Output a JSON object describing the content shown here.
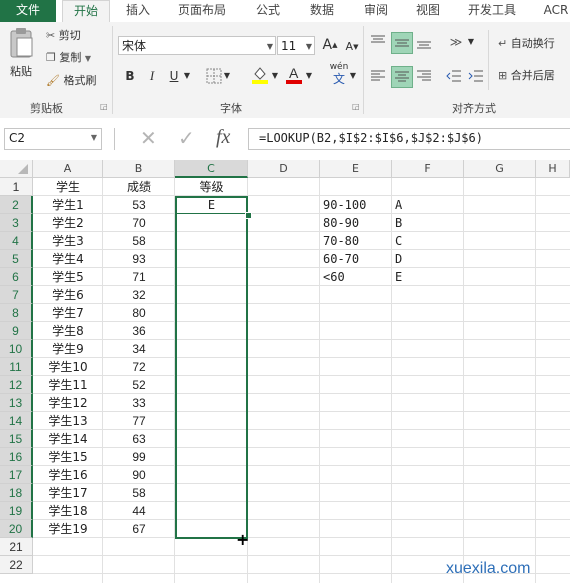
{
  "tabs": [
    "文件",
    "开始",
    "插入",
    "页面布局",
    "公式",
    "数据",
    "审阅",
    "视图",
    "开发工具",
    "ACR"
  ],
  "active_tab": "开始",
  "clipboard": {
    "paste_label": "粘贴",
    "cut_label": "剪切",
    "copy_label": "复制",
    "format_painter_label": "格式刷",
    "group_label": "剪贴板"
  },
  "font": {
    "name": "宋体",
    "size": "11",
    "grow_label": "A",
    "shrink_label": "A",
    "bold_label": "B",
    "italic_label": "I",
    "underline_label": "U",
    "wen_label": "wén",
    "wen_sub": "文",
    "group_label": "字体"
  },
  "alignment": {
    "wrap_label": "自动换行",
    "merge_label": "合并后居",
    "group_label": "对齐方式"
  },
  "formula_bar": {
    "name_box": "C2",
    "cancel_symbol": "✕",
    "enter_symbol": "✓",
    "fx_label": "fx",
    "formula": "=LOOKUP(B2,$I$2:$I$6,$J$2:$J$6)"
  },
  "sheet": {
    "columns": [
      "A",
      "B",
      "C",
      "D",
      "E",
      "F",
      "G",
      "H"
    ],
    "selected_column": "C",
    "row_numbers": [
      "1",
      "2",
      "3",
      "4",
      "5",
      "6",
      "7",
      "8",
      "9",
      "10",
      "11",
      "12",
      "13",
      "14",
      "15",
      "16",
      "17",
      "18",
      "19",
      "20",
      "21",
      "22"
    ],
    "headers": {
      "a": "学生",
      "b": "成绩",
      "c": "等级"
    },
    "students": [
      "学生1",
      "学生2",
      "学生3",
      "学生4",
      "学生5",
      "学生6",
      "学生7",
      "学生8",
      "学生9",
      "学生10",
      "学生11",
      "学生12",
      "学生13",
      "学生14",
      "学生15",
      "学生16",
      "学生17",
      "学生18",
      "学生19"
    ],
    "scores": [
      "53",
      "70",
      "58",
      "93",
      "71",
      "32",
      "80",
      "36",
      "34",
      "72",
      "52",
      "33",
      "77",
      "63",
      "99",
      "90",
      "58",
      "44",
      "67"
    ],
    "c2_value": "E",
    "ranges": [
      "90-100",
      "80-90",
      "70-80",
      "60-70",
      "<60"
    ],
    "grades": [
      "A",
      "B",
      "C",
      "D",
      "E"
    ]
  },
  "watermark": "xuexila.com",
  "colors": {
    "accent": "#217346",
    "watermark": "#2e6fb8"
  }
}
